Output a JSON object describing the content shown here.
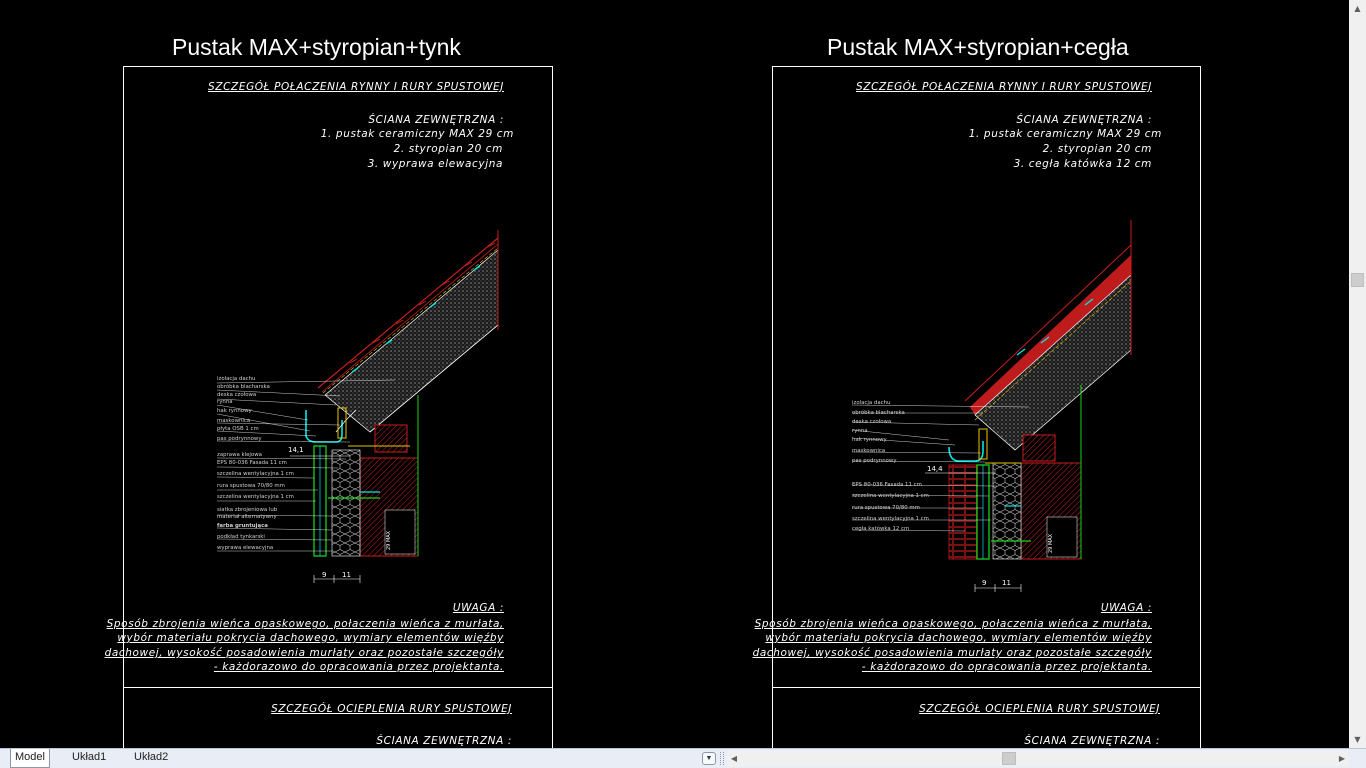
{
  "left": {
    "title": "Pustak MAX+styropian+tynk",
    "detail_heading": "SZCZEGÓŁ POŁACZENIA RYNNY I RURY SPUSTOWEJ",
    "wall_heading": "ŚCIANA ZEWNĘTRZNA :",
    "wall_layers": [
      "1. pustak ceramiczny MAX 29 cm",
      "2. styropian 20 cm",
      "3. wyprawa elewacyjna"
    ],
    "labels": [
      "izolacja dachu",
      "obróbka blacharska",
      "deska czołowa",
      "rynna",
      "hak rynnowy",
      "maskownica",
      "płyta OSB 1 cm",
      "pas podrynnowy",
      "zaprawa klejowa",
      "EPS 80-036 Fasada 11 cm",
      "szczelina wentylacyjna 1 cm",
      "rura spustowa 70/80 mm",
      "szczelina wentylacyjna 1 cm",
      "siatka zbrojeniowa lub",
      "materiał alternatywny",
      "farba gruntująca",
      "podkład tynkarski",
      "wyprawa elewacyjna"
    ],
    "dim_main": "14,1",
    "dim_a": "9",
    "dim_b": "11",
    "note_heading": "UWAGA :",
    "note_lines": [
      "Sposób zbrojenia wieńca opaskowego, połaczenia wieńca z murłata,",
      "wybór materiału pokrycia dachowego, wymiary elementów więźby",
      "dachowej, wysokość posadowienia murłaty oraz pozostałe szczegóły",
      "- każdorazowo do opracowania przez projektanta."
    ],
    "detail2_heading": "SZCZEGÓŁ OCIEPLENIA RURY SPUSTOWEJ",
    "wall2_heading": "ŚCIANA ZEWNĘTRZNA :"
  },
  "right": {
    "title": "Pustak MAX+styropian+cegła",
    "detail_heading": "SZCZEGÓŁ POŁACZENIA RYNNY I RURY SPUSTOWEJ",
    "wall_heading": "ŚCIANA ZEWNĘTRZNA :",
    "wall_layers": [
      "1. pustak ceramiczny MAX 29 cm",
      "2. styropian 20 cm",
      "3. cegła katówka 12 cm"
    ],
    "labels": [
      "izolacja dachu",
      "obróbka blacharska",
      "deska czołowa",
      "rynna",
      "hak rynnowy",
      "maskownica",
      "pas podrynnowy",
      "EPS 80-036 Fasada 11 cm",
      "szczelina wentylacyjna 1 cm",
      "rura spustowa 70/80 mm",
      "szczelina wentylacyjna 1 cm",
      "cegła katówka 12 cm"
    ],
    "dim_main": "14,4",
    "dim_a": "9",
    "dim_b": "11",
    "note_heading": "UWAGA :",
    "note_lines": [
      "Sposób zbrojenia wieńca opaskowego, połaczenia wieńca z murłata,",
      "wybór materiału pokrycia dachowego, wymiary elementów więźby",
      "dachowej, wysokość posadowienia murłaty oraz pozostałe szczegóły",
      "- każdorazowo do opracowania przez projektanta."
    ],
    "detail2_heading": "SZCZEGÓŁ OCIEPLENIA RURY SPUSTOWEJ",
    "wall2_heading": "ŚCIANA ZEWNĘTRZNA :"
  },
  "tabs": [
    "Model",
    "Układ1",
    "Układ2"
  ],
  "active_tab": "Model",
  "icons": {
    "vscroll_up": "arrow-up-icon",
    "vscroll_down": "arrow-down-icon",
    "hscroll_left": "arrow-left-icon",
    "hscroll_right": "arrow-right-icon",
    "tab_menu": "chevron-down-icon"
  },
  "colors": {
    "background": "#000000",
    "frame": "#ffffff",
    "roof_red": "#c81e1e",
    "insulation": "#9a9a9a",
    "gutter_cyan": "#00e5e5",
    "pipe_green": "#19d219",
    "timber_yellow": "#e6c800"
  }
}
